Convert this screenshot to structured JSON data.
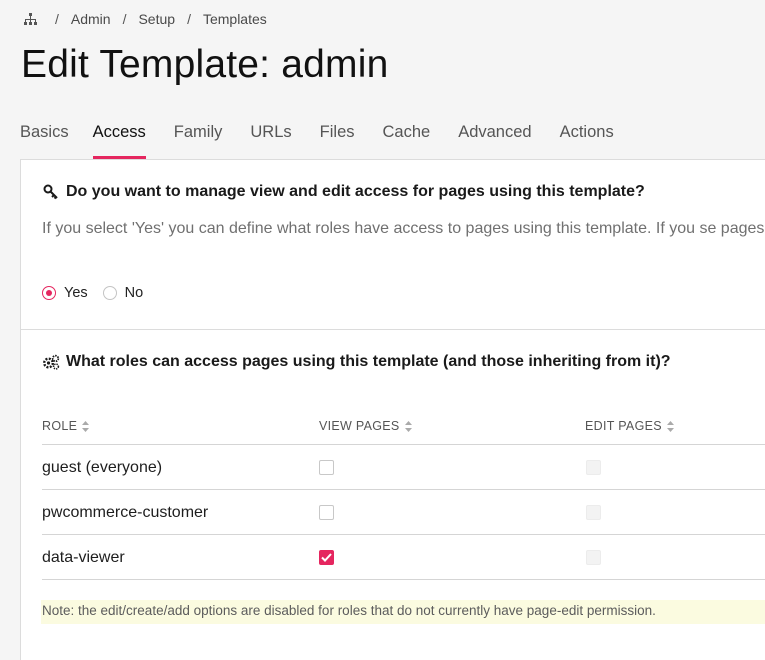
{
  "breadcrumb": {
    "home_icon": "sitemap-icon",
    "items": [
      "Admin",
      "Setup",
      "Templates"
    ],
    "separator": "/"
  },
  "page": {
    "title": "Edit Template: admin"
  },
  "tabs": [
    {
      "label": "Basics",
      "active": false
    },
    {
      "label": "Access",
      "active": true
    },
    {
      "label": "Family",
      "active": false
    },
    {
      "label": "URLs",
      "active": false
    },
    {
      "label": "Files",
      "active": false
    },
    {
      "label": "Cache",
      "active": false
    },
    {
      "label": "Advanced",
      "active": false
    },
    {
      "label": "Actions",
      "active": false
    }
  ],
  "access_section": {
    "icon": "key-icon",
    "title": "Do you want to manage view and edit access for pages using this template?",
    "description": "If you select 'Yes' you can define what roles have access to pages using this template. If you se pages.",
    "options": [
      {
        "label": "Yes",
        "checked": true
      },
      {
        "label": "No",
        "checked": false
      }
    ]
  },
  "roles_section": {
    "icon": "gears-icon",
    "title": "What roles can access pages using this template (and those inheriting from it)?",
    "columns": [
      "ROLE",
      "VIEW PAGES",
      "EDIT PAGES"
    ],
    "rows": [
      {
        "role": "guest (everyone)",
        "view": false,
        "edit_disabled": true
      },
      {
        "role": "pwcommerce-customer",
        "view": false,
        "edit_disabled": true
      },
      {
        "role": "data-viewer",
        "view": true,
        "edit_disabled": true
      }
    ],
    "note": "Note: the edit/create/add options are disabled for roles that do not currently have page-edit permission."
  },
  "colors": {
    "accent": "#e5265f",
    "note_bg": "#fbfbe0",
    "page_bg": "#f5f5f5"
  }
}
